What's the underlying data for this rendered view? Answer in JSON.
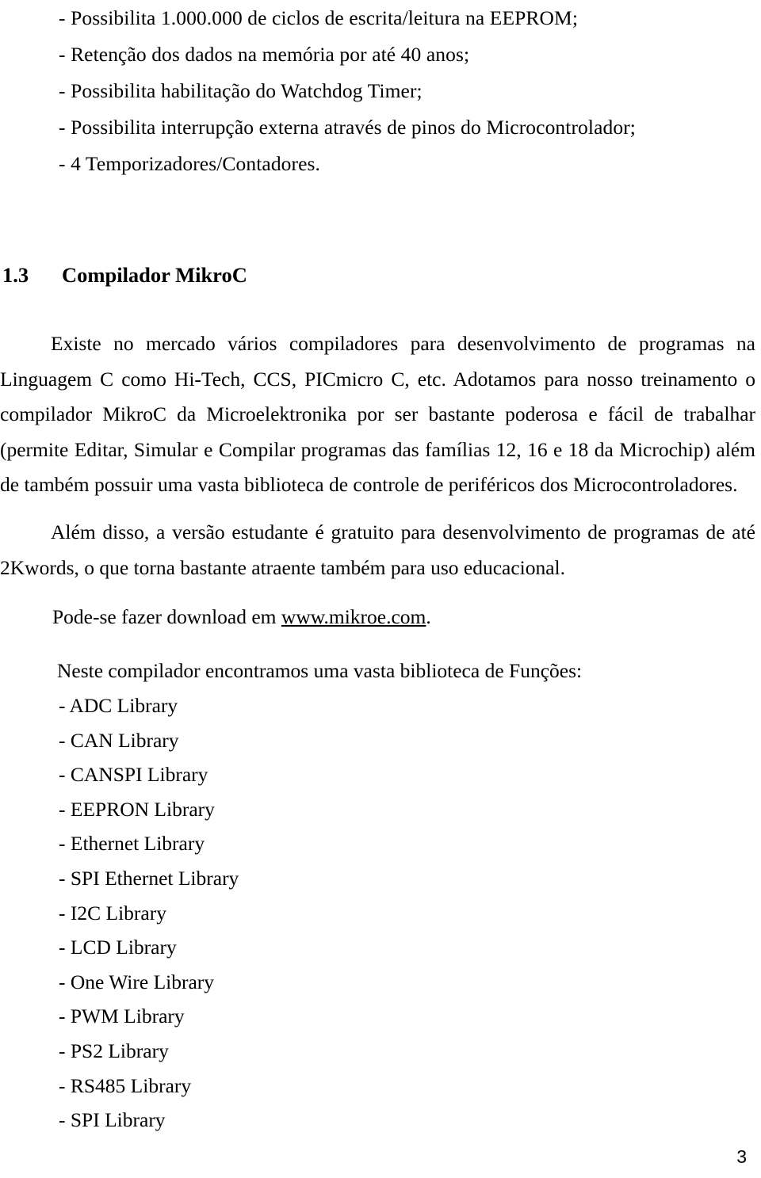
{
  "document": {
    "language": "pt-BR",
    "page_number": "3",
    "text_color": "#000000",
    "background_color": "#ffffff"
  },
  "features": {
    "items": [
      "- Possibilita 1.000.000 de ciclos de escrita/leitura na EEPROM;",
      "- Retenção dos dados na memória por até 40 anos;",
      "- Possibilita habilitação do Watchdog Timer;",
      "- Possibilita interrupção externa através de pinos do Microcontrolador;",
      "- 4 Temporizadores/Contadores."
    ]
  },
  "section": {
    "number": "1.3",
    "title": "Compilador MikroC"
  },
  "paragraphs": {
    "intro": "Existe no mercado vários compiladores para desenvolvimento de programas na Linguagem C como Hi-Tech, CCS, PICmicro C, etc. Adotamos para nosso treinamento o compilador MikroC da Microelektronika por ser bastante poderosa e fácil de trabalhar (permite Editar, Simular e Compilar programas das famílias 12, 16 e 18 da Microchip) além de também possuir uma vasta biblioteca de controle de periféricos dos Microcontroladores.",
    "student_version": "Além disso, a versão estudante é gratuito para desenvolvimento de programas de até 2Kwords, o que torna bastante atraente também para uso educacional.",
    "download_prefix": "Pode-se fazer download em ",
    "download_url": "www.mikroe.com",
    "download_suffix": ".",
    "libraries_intro": "Neste compilador encontramos uma vasta biblioteca de Funções:"
  },
  "libraries": {
    "items": [
      "- ADC Library",
      "- CAN Library",
      "- CANSPI Library",
      "- EEPRON Library",
      "- Ethernet Library",
      "- SPI Ethernet Library",
      "- I2C Library",
      "- LCD Library",
      "- One Wire Library",
      "- PWM Library",
      "- PS2 Library",
      "- RS485 Library",
      "- SPI Library"
    ]
  }
}
